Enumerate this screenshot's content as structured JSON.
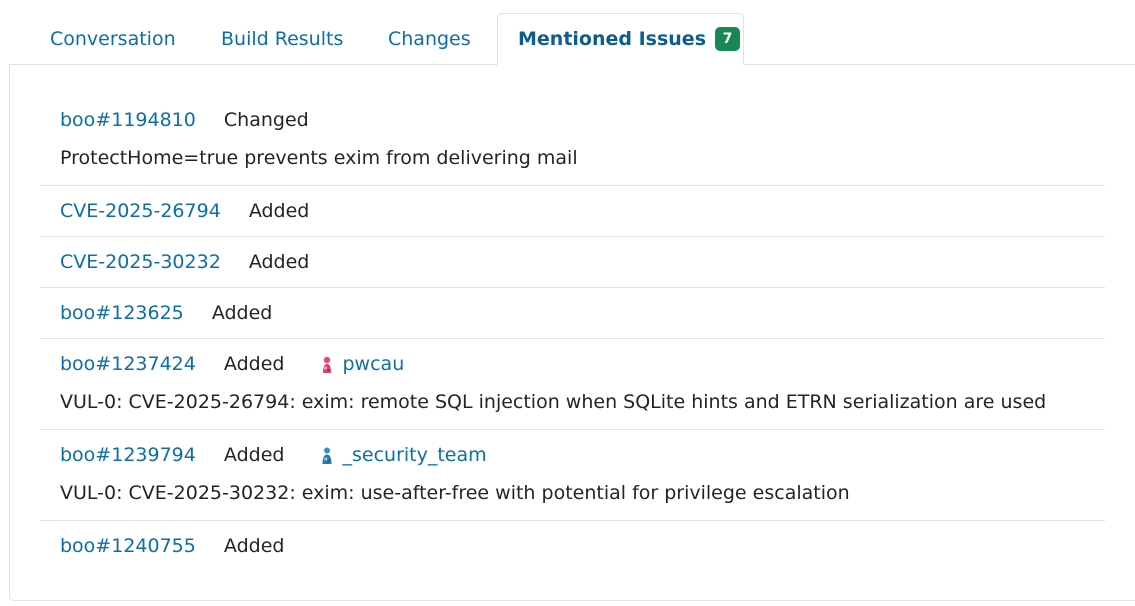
{
  "tabs": [
    {
      "label": "Conversation"
    },
    {
      "label": "Build Results"
    },
    {
      "label": "Changes"
    },
    {
      "label": "Mentioned Issues",
      "count": "7",
      "active": true
    }
  ],
  "issues": [
    {
      "id": "boo#1194810",
      "state": "Changed",
      "summary": "ProtectHome=true prevents exim from delivering mail"
    },
    {
      "id": "CVE-2025-26794",
      "state": "Added"
    },
    {
      "id": "CVE-2025-30232",
      "state": "Added"
    },
    {
      "id": "boo#123625",
      "state": "Added"
    },
    {
      "id": "boo#1237424",
      "state": "Added",
      "user": "pwcau",
      "avatar_icon": "pink-user-avatar-icon",
      "summary": "VUL-0: CVE-2025-26794: exim: remote SQL injection when SQLite hints and ETRN serialization are used"
    },
    {
      "id": "boo#1239794",
      "state": "Added",
      "user": "_security_team",
      "avatar_icon": "blue-team-avatar-icon",
      "summary": "VUL-0: CVE-2025-30232: exim: use-after-free with potential for privilege escalation"
    },
    {
      "id": "boo#1240755",
      "state": "Added"
    }
  ],
  "colors": {
    "link": "#0d6ea8",
    "badge": "#198754",
    "border": "#dee2e6"
  }
}
